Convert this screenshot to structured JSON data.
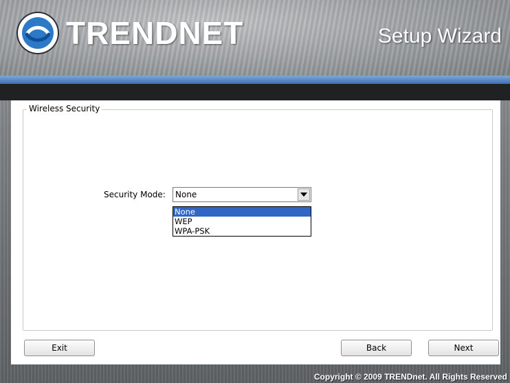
{
  "header": {
    "brand": "TRENDNET",
    "title": "Setup Wizard",
    "colors": {
      "accent_bar": "#3f6fb5",
      "band": "#1f2123"
    }
  },
  "group": {
    "title": "Wireless Security"
  },
  "security": {
    "label": "Security Mode:",
    "selected": "None",
    "options": [
      "None",
      "WEP",
      "WPA-PSK"
    ]
  },
  "buttons": {
    "exit": "Exit",
    "back": "Back",
    "next": "Next"
  },
  "footer": {
    "copyright": "Copyright © 2009 TRENDnet. All Rights Reserved"
  }
}
